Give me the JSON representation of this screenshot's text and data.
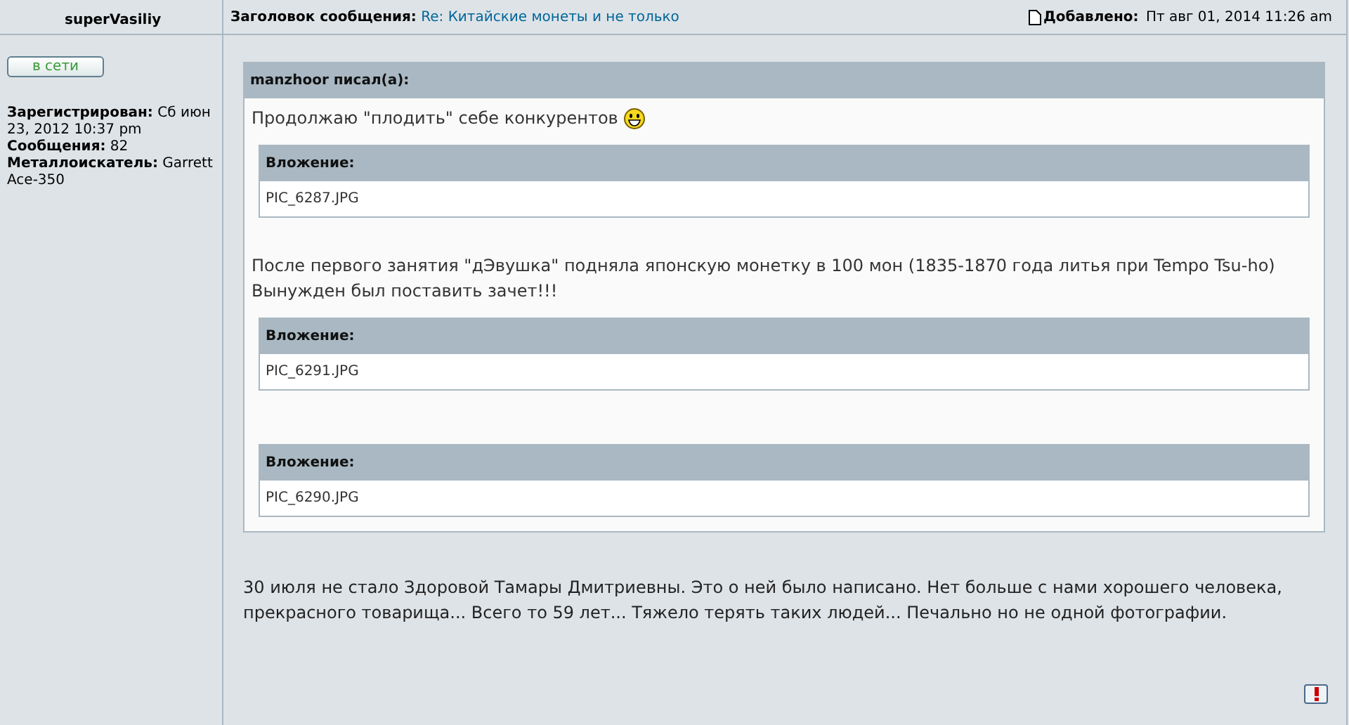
{
  "author": {
    "name": "superVasiliy",
    "status_button": "в сети",
    "details": [
      "**Зарегистрирован:** Сб июн 23, 2012 10:37 pm",
      "**Сообщения:** 82",
      "**Металлоискатель:** Garrett Ace-350"
    ]
  },
  "post_header": {
    "subject_label": "Заголовок сообщения:",
    "subject": "Re: Китайские монеты и не только",
    "posted_label": "Добавлено:",
    "posted": "Пт авг 01, 2014 11:26 am"
  },
  "quote": {
    "header": "manzhoor писал(а):",
    "blocks": [
      {
        "kind": "text",
        "lines": [
          "Продолжаю \"плодить\" себе конкурентов"
        ],
        "smiley": true
      },
      {
        "kind": "attachment",
        "label": "Вложение:",
        "file": "PIC_6287.JPG"
      },
      {
        "kind": "text",
        "lines": [
          "После первого занятия \"дЭвушка\" подняла японскую монетку в 100 мон (1835-1870 года литья при Tempo Tsu-ho)",
          "Вынужден был поставить зачет!!!"
        ]
      },
      {
        "kind": "attachment",
        "label": "Вложение:",
        "file": "PIC_6291.JPG"
      },
      {
        "kind": "gap"
      },
      {
        "kind": "attachment",
        "label": "Вложение:",
        "file": "PIC_6290.JPG"
      }
    ]
  },
  "post_text": "30 июля не стало Здоровой Тамары Дмитриевны. Это о ней было написано. Нет больше с нами хорошего человека, прекрасного товарища... Всего то 59 лет... Тяжело терять таких людей... Печально но не одной фотографии."
}
